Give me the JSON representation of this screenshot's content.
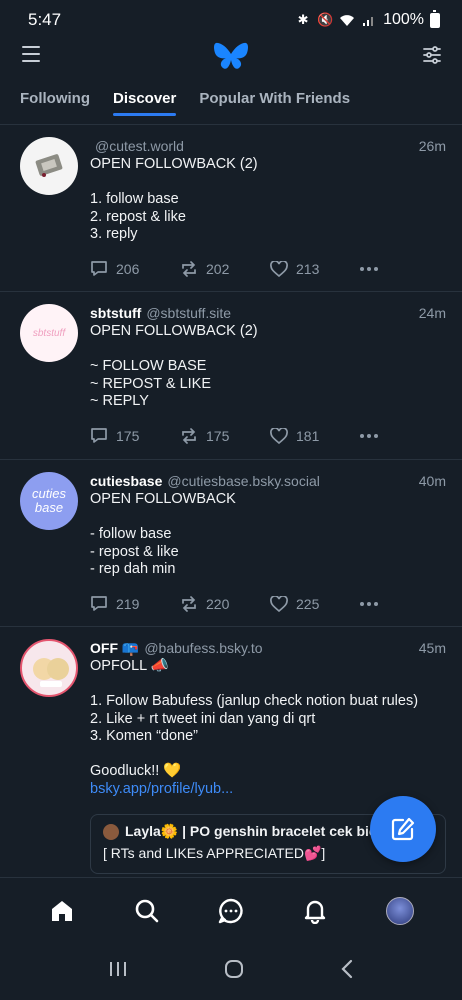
{
  "status_bar": {
    "time": "5:47",
    "battery": "100%"
  },
  "tabs": [
    {
      "label": "Following"
    },
    {
      "label": "Discover",
      "active": true
    },
    {
      "label": "Popular With Friends"
    }
  ],
  "posts": [
    {
      "author": "",
      "handle": "@cutest.world",
      "time": "26m",
      "body": "OPEN FOLLOWBACK (2)\n\n1. follow base\n2. repost & like\n3. reply",
      "replies": "206",
      "reposts": "202",
      "likes": "213"
    },
    {
      "author": "sbtstuff",
      "handle": "@sbtstuff.site",
      "time": "24m",
      "body": "OPEN FOLLOWBACK (2)\n\n~ FOLLOW BASE\n~ REPOST & LIKE\n~ REPLY",
      "replies": "175",
      "reposts": "175",
      "likes": "181",
      "avatar_text": "sbtstuff"
    },
    {
      "author": "cutiesbase",
      "handle": "@cutiesbase.bsky.social",
      "time": "40m",
      "body": "OPEN FOLLOWBACK\n\n- follow base\n- repost & like\n- rep dah min",
      "replies": "219",
      "reposts": "220",
      "likes": "225",
      "avatar_text": "cuties base"
    },
    {
      "author": "OFF 📪",
      "handle": "@babufess.bsky.to",
      "time": "45m",
      "body": "OPFOLL 📣\n\n1. Follow Babufess (janlup check notion buat rules)\n2. Like + rt tweet ini dan yang di qrt\n3. Komen “done”\n\nGoodluck!! 💛",
      "link": "bsky.app/profile/lyub...",
      "quote": {
        "author": "Layla🌼 | PO genshin bracelet cek bio",
        "body": "[ RTs and LIKEs APPRECIATED💕]"
      }
    }
  ],
  "colors": {
    "accent": "#2c7bf2",
    "background": "#161e27",
    "muted": "#8e9aa7"
  }
}
